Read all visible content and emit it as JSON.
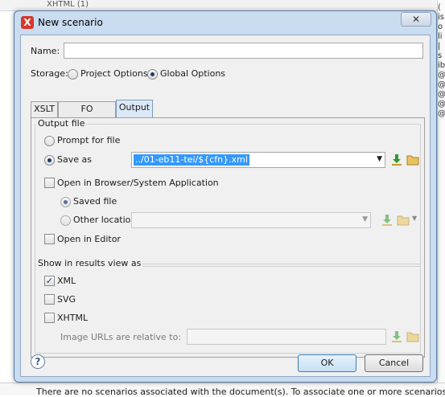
{
  "background": {
    "top_text": "XHTML (1)",
    "side_letters": [
      "(",
      "is",
      "o",
      "li",
      "|",
      "s",
      "",
      "ib",
      "@",
      "@",
      "@",
      "@",
      "@"
    ],
    "bottom_text": "There are no scenarios associated with the document(s). To associate one or more scenarios,"
  },
  "dialog": {
    "title": "New scenario",
    "close_glyph": "✕"
  },
  "form": {
    "name_label": "Name:",
    "name_value": "",
    "storage_label": "Storage:",
    "storage_options": [
      "Project Options",
      "Global Options"
    ],
    "storage_selected": "Global Options"
  },
  "tabs": [
    {
      "label": "XSLT",
      "active": false
    },
    {
      "label": "FO Processor",
      "active": false
    },
    {
      "label": "Output",
      "active": true
    }
  ],
  "output_file": {
    "group_title": "Output file",
    "prompt_label": "Prompt for file",
    "save_as_label": "Save as",
    "save_as_value": "../01-eb11-tei/${cfn}.xml",
    "open_browser_label": "Open in Browser/System Application",
    "saved_file_label": "Saved file",
    "other_location_label": "Other location",
    "other_location_value": "",
    "open_editor_label": "Open in Editor"
  },
  "results_view": {
    "group_title": "Show in results view as",
    "xml_label": "XML",
    "xml_checked": true,
    "svg_label": "SVG",
    "svg_checked": false,
    "xhtml_label": "XHTML",
    "xhtml_checked": false,
    "image_urls_label": "Image URLs are relative to:",
    "image_urls_value": ""
  },
  "footer": {
    "help_glyph": "?",
    "ok_label": "OK",
    "cancel_label": "Cancel"
  },
  "colors": {
    "accent": "#3399ff",
    "title_bar": "#c9dcf0",
    "download_green": "#2f9a2f",
    "folder_yellow": "#e9c35a"
  },
  "icons": {
    "app": "oxygen-x-icon",
    "download": "download-arrow-icon",
    "folder": "folder-icon",
    "help": "help-icon"
  }
}
